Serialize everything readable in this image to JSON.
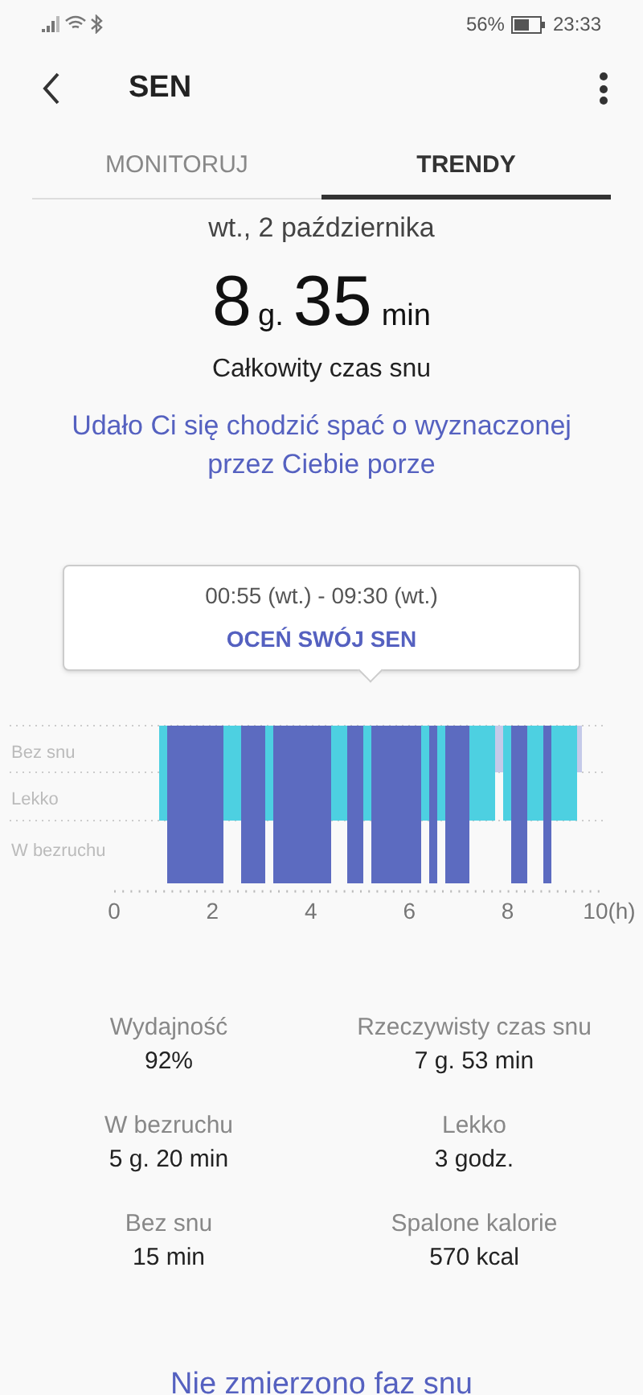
{
  "status_bar": {
    "battery": "56%",
    "time": "23:33"
  },
  "header": {
    "title": "SEN"
  },
  "tabs": [
    {
      "label": "MONITORUJ",
      "selected": false
    },
    {
      "label": "TRENDY",
      "selected": true
    }
  ],
  "date": "wt., 2 października",
  "duration": {
    "hours": "8",
    "hours_unit": "g.",
    "minutes": "35",
    "minutes_unit": "min"
  },
  "duration_caption": "Całkowity czas snu",
  "goal_message": "Udało Ci się chodzić spać o wyznaczonej przez Ciebie porze",
  "tooltip": {
    "time_range": "00:55 (wt.) - 09:30 (wt.)",
    "action": "OCEŃ SWÓJ SEN"
  },
  "chart": {
    "stage_labels": [
      "Bez snu",
      "Lekko",
      "W bezruchu"
    ],
    "x_labels": [
      "0",
      "2",
      "4",
      "6",
      "8",
      "10(h)"
    ]
  },
  "stats": [
    {
      "label": "Wydajność",
      "value": "92%"
    },
    {
      "label": "Rzeczywisty czas snu",
      "value": "7 g. 53 min"
    },
    {
      "label": "W bezruchu",
      "value": "5 g. 20 min"
    },
    {
      "label": "Lekko",
      "value": "3 godz."
    },
    {
      "label": "Bez snu",
      "value": "15 min"
    },
    {
      "label": "Spalone kalorie",
      "value": "570 kcal"
    }
  ],
  "footer_link": "Nie zmierzono faz snu"
}
